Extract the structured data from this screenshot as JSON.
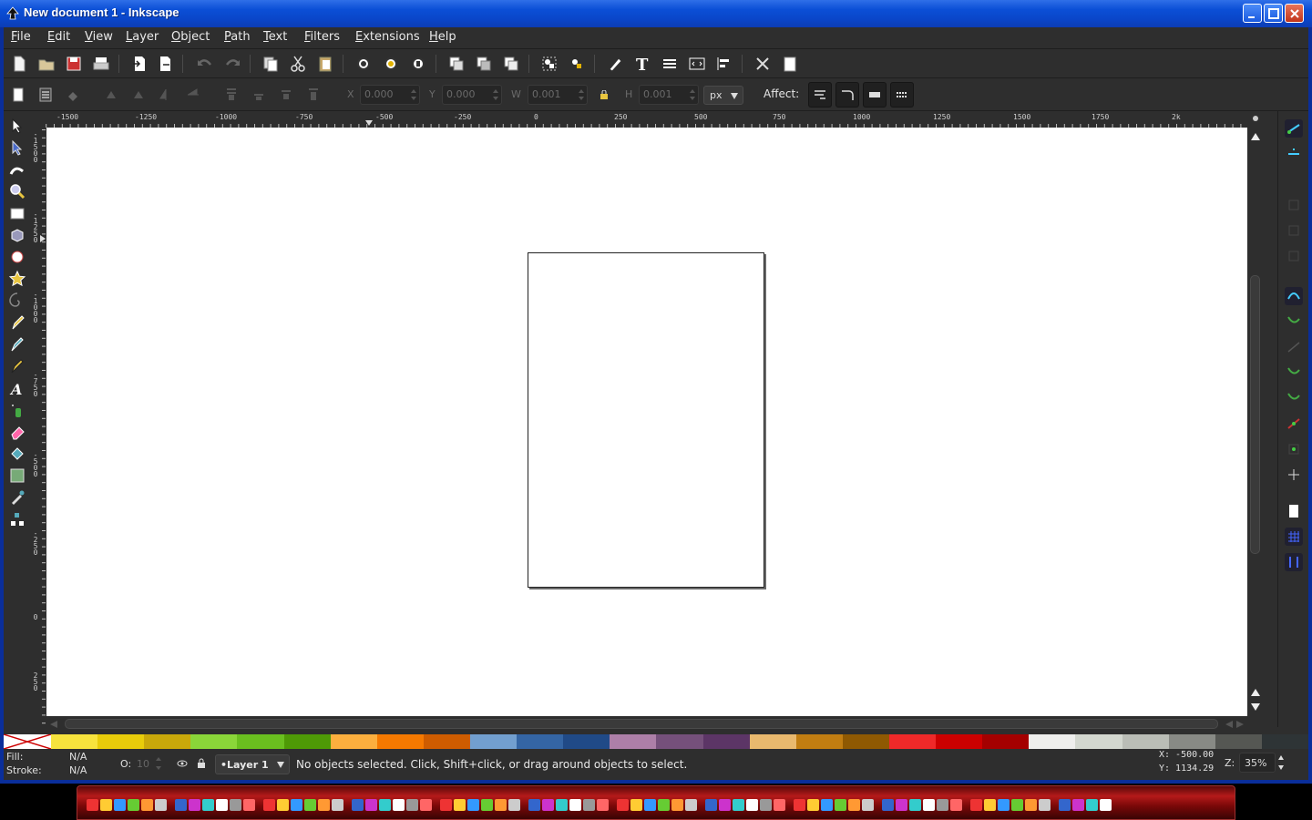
{
  "window": {
    "title": "New document 1 - Inkscape",
    "buttons": [
      "minimize",
      "maximize",
      "close"
    ]
  },
  "menubar": {
    "items": [
      {
        "label": "File"
      },
      {
        "label": "Edit"
      },
      {
        "label": "View"
      },
      {
        "label": "Layer"
      },
      {
        "label": "Object"
      },
      {
        "label": "Path"
      },
      {
        "label": "Text"
      },
      {
        "label": "Filters"
      },
      {
        "label": "Extensions"
      },
      {
        "label": "Help"
      }
    ]
  },
  "commands_bar": {
    "icons": [
      "new-icon",
      "open-icon",
      "save-icon",
      "print-icon",
      "import-icon",
      "export-icon",
      "undo-icon",
      "redo-icon",
      "copy-icon",
      "cut-icon",
      "paste-icon",
      "zoom-selection-icon",
      "zoom-drawing-icon",
      "zoom-page-icon",
      "duplicate-icon",
      "clone-icon",
      "unlink-clone-icon",
      "group-icon",
      "ungroup-icon",
      "fill-stroke-icon",
      "text-font-icon",
      "layers-icon",
      "xml-editor-icon",
      "align-distribute-icon",
      "preferences-icon",
      "document-properties-icon"
    ]
  },
  "tool_controls": {
    "x_label": "X",
    "x_value": "0.000",
    "y_label": "Y",
    "y_value": "0.000",
    "w_label": "W",
    "w_value": "0.001",
    "h_label": "H",
    "h_value": "0.001",
    "unit": "px",
    "affect_label": "Affect:"
  },
  "rulers": {
    "top_labels": [
      "-1500",
      "-1250",
      "-1000",
      "-750",
      "-500",
      "-250",
      "0",
      "250",
      "500",
      "750",
      "1000",
      "1250",
      "1500",
      "1750",
      "2k"
    ],
    "left_labels": [
      "-1500",
      "-1250",
      "-1000",
      "-750",
      "-500",
      "-250",
      "0",
      "250"
    ]
  },
  "palette": {
    "colors": [
      "#f7e33d",
      "#e8cc0a",
      "#c9a80a",
      "#8ad639",
      "#6abf1f",
      "#4e9a06",
      "#fcaf3e",
      "#f57900",
      "#ce5c00",
      "#729fcf",
      "#3465a4",
      "#204a87",
      "#ad7fa8",
      "#75507b",
      "#5c3566",
      "#e9b96e",
      "#c17d11",
      "#8f5902",
      "#ef2929",
      "#cc0000",
      "#a40000",
      "#eeeeec",
      "#d3d7cf",
      "#babdb6",
      "#888a85",
      "#555753",
      "#2e3436"
    ]
  },
  "statusbar": {
    "fill_label": "Fill:",
    "fill_value": "N/A",
    "stroke_label": "Stroke:",
    "stroke_value": "N/A",
    "opacity_label": "O:",
    "opacity_value": "10",
    "layer": "•Layer 1",
    "message": "No objects selected. Click, Shift+click, or drag around objects to select.",
    "cursor_x": "X: -500.00",
    "cursor_y": "Y: 1134.29",
    "zoom_label": "Z:",
    "zoom_value": "35%"
  }
}
